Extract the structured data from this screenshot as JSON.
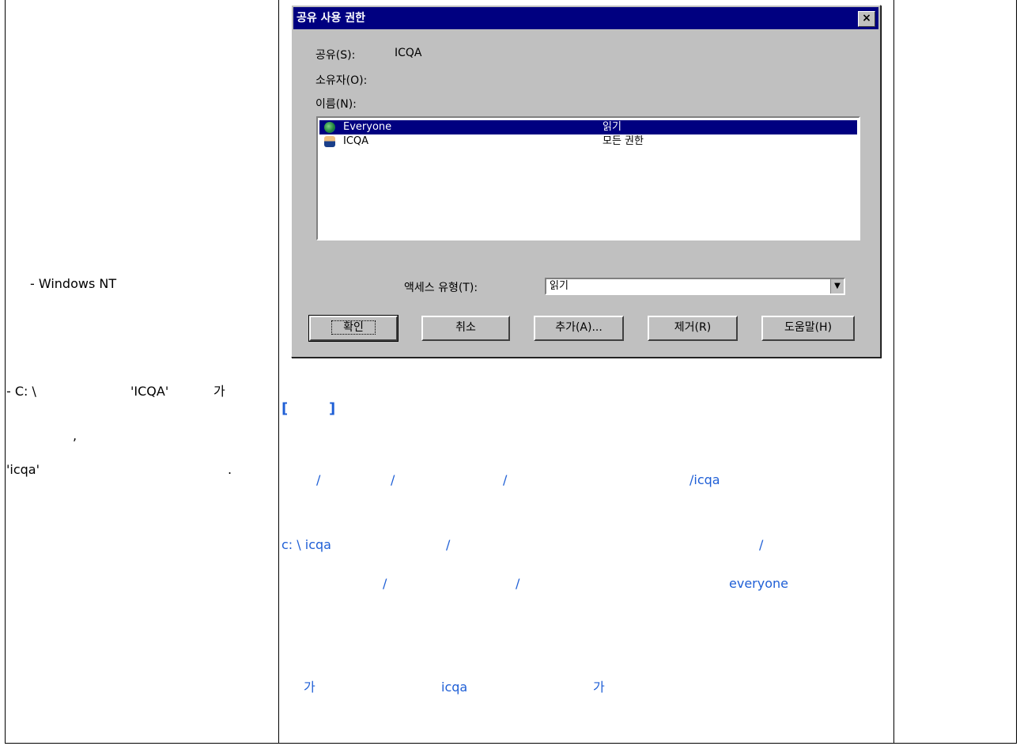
{
  "left_column": {
    "line1": "- Windows NT",
    "line2a": "- C: \\",
    "line2b": "'ICQA'",
    "line2c": "가",
    "line3": ",",
    "line4a": "'icqa'",
    "line4b": "."
  },
  "dialog": {
    "title": "공유 사용 권한",
    "close_glyph": "×",
    "share_label": "공유(S):",
    "share_value": "ICQA",
    "owner_label": "소유자(O):",
    "name_label": "이름(N):",
    "entries": [
      {
        "name": "Everyone",
        "permission": "읽기",
        "icon": "globe-icon",
        "selected": true
      },
      {
        "name": "ICQA",
        "permission": "모든 권한",
        "icon": "user-icon",
        "selected": false
      }
    ],
    "access_type_label": "액세스 유형(T):",
    "access_type_value": "읽기",
    "buttons": {
      "ok": "확인",
      "cancel": "취소",
      "add": "추가(A)...",
      "remove": "제거(R)",
      "help": "도움말(H)"
    }
  },
  "right_text": {
    "bracket_open": "[",
    "bracket_close": "]",
    "l1_a": "/",
    "l1_b": "/",
    "l1_c": "/",
    "l1_d": "/icqa",
    "l2_a": "c: \\ icqa",
    "l2_b": "/",
    "l2_c": "/",
    "l3_a": "/",
    "l3_b": "/",
    "l3_c": "everyone",
    "l4_a": "가",
    "l4_b": "icqa",
    "l4_c": "가"
  }
}
